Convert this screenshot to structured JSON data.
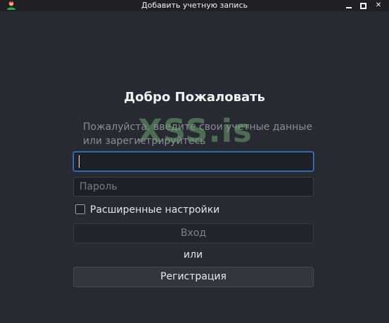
{
  "window": {
    "title": "Добавить учетную запись",
    "icon": "user-avatar-icon",
    "controls": [
      "minimize-icon",
      "maximize-icon",
      "close-icon"
    ]
  },
  "form": {
    "heading": "Добро Пожаловать",
    "subtitle": "Пожалуйста, введите свои учетные данные или зарегистрируйтесь",
    "login_value": "",
    "password_placeholder": "Пароль",
    "advanced_settings_label": "Расширенные настройки",
    "advanced_settings_checked": false,
    "login_button": "Вход",
    "or_text": "или",
    "register_button": "Регистрация"
  },
  "watermark": "XSS.is",
  "colors": {
    "background": "#282a33",
    "focus_border": "#3d7fdc",
    "watermark": "#6ea06e"
  }
}
